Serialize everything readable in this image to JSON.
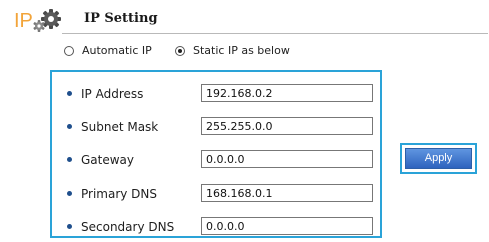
{
  "header": {
    "logo_text": "IP",
    "title": "IP Setting"
  },
  "mode": {
    "options": [
      {
        "label": "Automatic IP",
        "selected": false
      },
      {
        "label": "Static IP as below",
        "selected": true
      }
    ]
  },
  "fields": [
    {
      "label": "IP Address",
      "value": "192.168.0.2"
    },
    {
      "label": "Subnet Mask",
      "value": "255.255.0.0"
    },
    {
      "label": "Gateway",
      "value": "0.0.0.0"
    },
    {
      "label": "Primary DNS",
      "value": "168.168.0.1"
    },
    {
      "label": "Secondary DNS",
      "value": "0.0.0.0"
    }
  ],
  "actions": {
    "apply_label": "Apply"
  },
  "colors": {
    "highlight_border": "#2aa3d8",
    "bullet": "#1f4f8c",
    "button_top": "#5f95e0",
    "button_bottom": "#2e63be",
    "logo_text": "#f2a43a"
  }
}
